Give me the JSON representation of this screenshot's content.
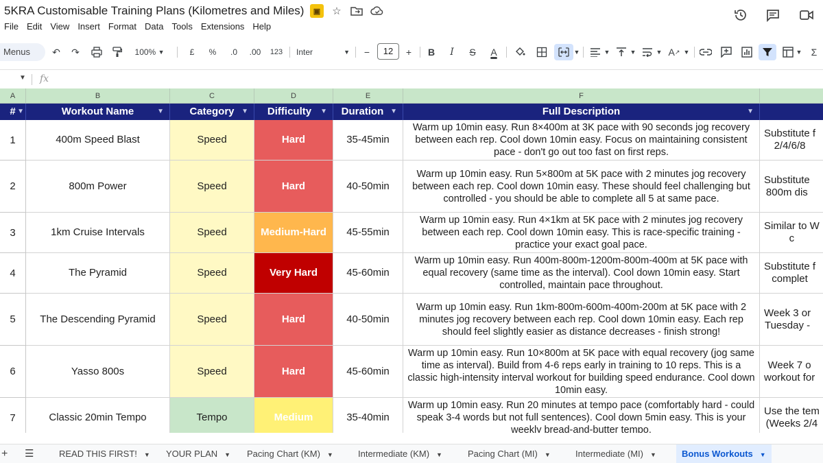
{
  "doc": {
    "title": "5KRA Customisable Training Plans (Kilometres and Miles)",
    "badge_icon": "drive-shortcut-icon"
  },
  "menu": [
    "File",
    "Edit",
    "View",
    "Insert",
    "Format",
    "Data",
    "Tools",
    "Extensions",
    "Help"
  ],
  "toolbar": {
    "menus_label": "Menus",
    "zoom": "100%",
    "currency": "£",
    "percent": "%",
    "dec_decrease": ".0",
    "dec_increase": ".00",
    "number_format": "123",
    "font": "Inter",
    "font_size": "12",
    "minus": "−",
    "plus": "+",
    "bold": "B",
    "italic": "I",
    "strike": "S",
    "text_color": "A",
    "sigma": "Σ"
  },
  "formula": {
    "fx": "fx"
  },
  "columns": [
    "A",
    "B",
    "C",
    "D",
    "E",
    "F"
  ],
  "headers": {
    "num": "#",
    "name": "Workout Name",
    "category": "Category",
    "difficulty": "Difficulty",
    "duration": "Duration",
    "description": "Full Description"
  },
  "rows": [
    {
      "num": "1",
      "name": "400m Speed Blast",
      "category": "Speed",
      "difficulty": "Hard",
      "duration": "35-45min",
      "description": "Warm up 10min easy. Run 8×400m at 3K pace with 90 seconds jog recovery between each rep. Cool down 10min easy. Focus on maintaining consistent pace - don't go out too fast on first reps.",
      "extra": "Substitute f\n2/4/6/8"
    },
    {
      "num": "2",
      "name": "800m Power",
      "category": "Speed",
      "difficulty": "Hard",
      "duration": "40-50min",
      "description": "Warm up 10min easy. Run 5×800m at 5K pace with 2 minutes jog recovery between each rep. Cool down 10min easy. These should feel challenging but controlled - you should be able to complete all 5 at same pace.",
      "extra": "Substitute\n800m dis"
    },
    {
      "num": "3",
      "name": "1km Cruise Intervals",
      "category": "Speed",
      "difficulty": "Medium-Hard",
      "duration": "45-55min",
      "description": "Warm up 10min easy. Run 4×1km at 5K pace with 2 minutes jog recovery between each rep. Cool down 10min easy. This is race-specific training - practice your exact goal pace.",
      "extra": "Similar to W\nc"
    },
    {
      "num": "4",
      "name": "The Pyramid",
      "category": "Speed",
      "difficulty": "Very Hard",
      "duration": "45-60min",
      "description": "Warm up 10min easy. Run 400m-800m-1200m-800m-400m at 5K pace with equal recovery (same time as the interval). Cool down 10min easy. Start controlled, maintain pace throughout.",
      "extra": "Substitute f\ncomplet"
    },
    {
      "num": "5",
      "name": "The Descending Pyramid",
      "category": "Speed",
      "difficulty": "Hard",
      "duration": "40-50min",
      "description": "Warm up 10min easy. Run 1km-800m-600m-400m-200m at 5K pace with 2 minutes jog recovery between each rep. Cool down 10min easy. Each rep should feel slightly easier as distance decreases - finish strong!",
      "extra": "Week 3 or\nTuesday -"
    },
    {
      "num": "6",
      "name": "Yasso 800s",
      "category": "Speed",
      "difficulty": "Hard",
      "duration": "45-60min",
      "description": "Warm up 10min easy. Run 10×800m at 5K pace with equal recovery (jog same time as interval). Build from 4-6 reps early in training to 10 reps. This is a classic high-intensity interval workout for building speed endurance. Cool down 10min easy.",
      "extra": "Week 7 o\nworkout for"
    },
    {
      "num": "7",
      "name": "Classic 20min Tempo",
      "category": "Tempo",
      "difficulty": "Medium",
      "duration": "35-40min",
      "description": "Warm up 10min easy. Run 20 minutes at tempo pace (comfortably hard - could speak 3-4 words but not full sentences). Cool down 5min easy. This is your weekly bread-and-butter tempo.",
      "extra": "Use the tem\n(Weeks 2/4"
    }
  ],
  "sheet_tabs": [
    "READ THIS FIRST!",
    "YOUR PLAN",
    "Pacing Chart (KM)",
    "Intermediate (KM)",
    "Pacing Chart (MI)",
    "Intermediate (MI)",
    "Bonus Workouts"
  ],
  "active_tab": "Bonus Workouts",
  "colors": {
    "header_bg": "#1a237e",
    "colhdr_bg": "#c8e6c9",
    "speed": "#fff9c4",
    "tempo": "#c8e6c9",
    "hard": "#e75c5c",
    "medium_hard": "#ffb74d",
    "very_hard": "#c00000",
    "medium": "#fff176"
  }
}
